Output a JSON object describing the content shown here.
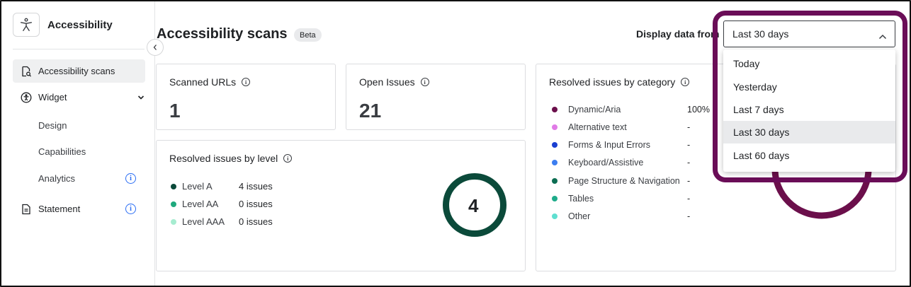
{
  "app": {
    "title": "Accessibility"
  },
  "sidebar": {
    "items": [
      {
        "label": "Accessibility scans",
        "icon": "scan-document-icon",
        "active": true
      },
      {
        "label": "Widget",
        "icon": "accessibility-person-icon"
      },
      {
        "label": "Design"
      },
      {
        "label": "Capabilities"
      },
      {
        "label": "Analytics",
        "icon": "info-icon"
      },
      {
        "label": "Statement",
        "icon": "document-icon"
      }
    ]
  },
  "header": {
    "title": "Accessibility scans",
    "badge": "Beta",
    "display_label": "Display data from"
  },
  "stats": {
    "scanned_urls": {
      "label": "Scanned URLs",
      "value": "1"
    },
    "open_issues": {
      "label": "Open Issues",
      "value": "21"
    }
  },
  "by_level": {
    "title": "Resolved issues by level",
    "total": "4",
    "rows": [
      {
        "name": "Level A",
        "value": "4 issues",
        "color": "#0b4a3a"
      },
      {
        "name": "Level AA",
        "value": "0 issues",
        "color": "#1fa97d"
      },
      {
        "name": "Level AAA",
        "value": "0 issues",
        "color": "#a6ecd0"
      }
    ],
    "ring_color": "#0b4a3a"
  },
  "by_category": {
    "title": "Resolved issues by category",
    "rows": [
      {
        "name": "Dynamic/Aria",
        "value": "100%",
        "color": "#6b0f4b"
      },
      {
        "name": "Alternative text",
        "value": "-",
        "color": "#e07be6"
      },
      {
        "name": "Forms & Input Errors",
        "value": "-",
        "color": "#1a3fd1"
      },
      {
        "name": "Keyboard/Assistive",
        "value": "-",
        "color": "#3c7ef0"
      },
      {
        "name": "Page Structure & Navigation",
        "value": "-",
        "color": "#0c6d52"
      },
      {
        "name": "Tables",
        "value": "-",
        "color": "#1eab8a"
      },
      {
        "name": "Other",
        "value": "-",
        "color": "#5fdfd0"
      }
    ],
    "ring_color": "#6b0f4b"
  },
  "date_range": {
    "selected": "Last 30 days",
    "options": [
      "Today",
      "Yesterday",
      "Last 7 days",
      "Last 30 days",
      "Last 60 days"
    ],
    "highlight_color": "#6a0d57"
  }
}
